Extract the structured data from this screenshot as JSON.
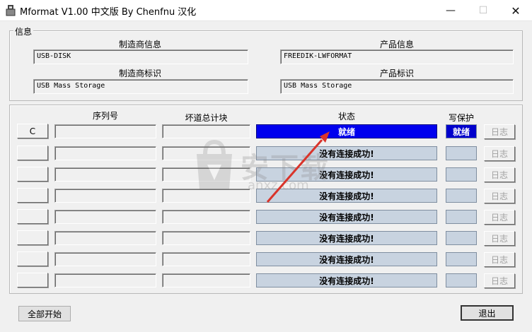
{
  "window": {
    "title": "Mformat V1.00 中文版 By Chenfnu 汉化"
  },
  "info": {
    "legend": "信息",
    "vendor_info_label": "制造商信息",
    "vendor_info_value": "USB-DISK",
    "product_info_label": "产品信息",
    "product_info_value": "FREEDIK-LWFORMAT",
    "vendor_id_label": "制造商标识",
    "vendor_id_value": "USB Mass Storage",
    "product_id_label": "产品标识",
    "product_id_value": "USB Mass Storage"
  },
  "table": {
    "headers": {
      "serial": "序列号",
      "bad_blocks": "坏道总计块",
      "status": "状态",
      "write_protect": "写保护"
    },
    "log_label": "日志",
    "rows": [
      {
        "port": "C",
        "status": "就绪",
        "write_protect": "就绪",
        "active": true
      },
      {
        "port": "",
        "status": "没有连接成功!",
        "write_protect": "",
        "active": false
      },
      {
        "port": "",
        "status": "没有连接成功!",
        "write_protect": "",
        "active": false
      },
      {
        "port": "",
        "status": "没有连接成功!",
        "write_protect": "",
        "active": false
      },
      {
        "port": "",
        "status": "没有连接成功!",
        "write_protect": "",
        "active": false
      },
      {
        "port": "",
        "status": "没有连接成功!",
        "write_protect": "",
        "active": false
      },
      {
        "port": "",
        "status": "没有连接成功!",
        "write_protect": "",
        "active": false
      },
      {
        "port": "",
        "status": "没有连接成功!",
        "write_protect": "",
        "active": false
      }
    ]
  },
  "footer": {
    "start_all_label": "全部开始",
    "exit_label": "退出"
  },
  "watermark": {
    "text": "安下载",
    "sub": "anxz.com"
  },
  "colors": {
    "ready_bg": "#0000ee",
    "idle_bg": "#c8d3e0",
    "arrow": "#d9342b"
  }
}
